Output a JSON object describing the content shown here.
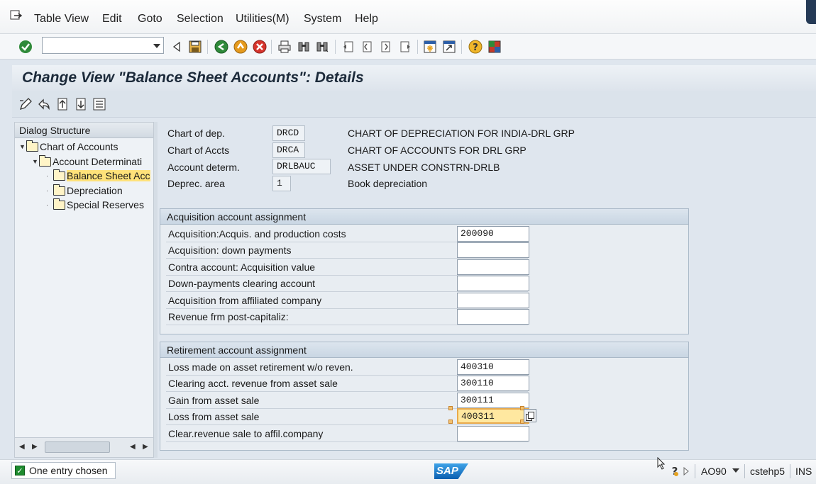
{
  "menubar": {
    "items": [
      "Table View",
      "Edit",
      "Goto",
      "Selection",
      "Utilities(M)",
      "System",
      "Help"
    ]
  },
  "toolbar": {
    "command_field": {
      "value": "",
      "placeholder": ""
    },
    "icons": [
      "enter-check-icon",
      "back-triangle-icon",
      "save-icon",
      "back-icon",
      "exit-icon",
      "cancel-icon",
      "print-icon",
      "find-icon",
      "find-next-icon",
      "first-page-icon",
      "prev-page-icon",
      "next-page-icon",
      "last-page-icon",
      "create-session-icon",
      "shortcut-icon",
      "help-icon",
      "customize-layout-icon"
    ]
  },
  "page": {
    "title": "Change View \"Balance Sheet Accounts\": Details"
  },
  "app_toolbar": {
    "icons": [
      "edit-icon",
      "undo-icon",
      "previous-entry-icon",
      "next-entry-icon",
      "variable-list-icon"
    ]
  },
  "tree": {
    "heading": "Dialog Structure",
    "items": [
      {
        "label": "Chart of Accounts",
        "level": 0,
        "expanded": true,
        "selected": false
      },
      {
        "label": "Account Determinati",
        "level": 1,
        "expanded": true,
        "selected": false
      },
      {
        "label": "Balance Sheet Acc",
        "level": 2,
        "expanded": false,
        "selected": true
      },
      {
        "label": "Depreciation",
        "level": 2,
        "expanded": false,
        "selected": false
      },
      {
        "label": "Special Reserves",
        "level": 2,
        "expanded": false,
        "selected": false
      }
    ]
  },
  "header_fields": [
    {
      "label": "Chart of dep.",
      "value": "DRCD",
      "description": "CHART OF DEPRECIATION FOR INDIA-DRL GRP"
    },
    {
      "label": "Chart of Accts",
      "value": "DRCA",
      "description": "CHART OF ACCOUNTS FOR DRL GRP"
    },
    {
      "label": "Account determ.",
      "value": "DRLBAUC",
      "description": "ASSET UNDER CONSTRN-DRLB"
    },
    {
      "label": "Deprec. area",
      "value": "1",
      "description": "Book depreciation"
    }
  ],
  "acquisition": {
    "title": "Acquisition account assignment",
    "rows": [
      {
        "label": "Acquisition:Acquis. and production costs",
        "value": "200090"
      },
      {
        "label": "Acquisition: down payments",
        "value": ""
      },
      {
        "label": "Contra account: Acquisition value",
        "value": ""
      },
      {
        "label": "Down-payments clearing account",
        "value": ""
      },
      {
        "label": "Acquisition from affiliated company",
        "value": ""
      },
      {
        "label": "Revenue frm post-capitaliz:",
        "value": ""
      }
    ]
  },
  "retirement": {
    "title": "Retirement account assignment",
    "rows": [
      {
        "label": "Loss made on asset retirement w/o reven.",
        "value": "400310"
      },
      {
        "label": "Clearing acct. revenue from asset sale",
        "value": "300110"
      },
      {
        "label": "Gain from asset sale",
        "value": "300111"
      },
      {
        "label": "Loss from asset sale",
        "value": "400311"
      },
      {
        "label": "Clear.revenue sale to affil.company",
        "value": ""
      }
    ]
  },
  "status": {
    "message": "One entry chosen",
    "logo": "SAP",
    "transaction": "AO90",
    "server": "cstehp5",
    "mode": "INS"
  },
  "colors": {
    "focus_field": "#ffe8a0",
    "selected_tree": "#ffe27a",
    "title_text": "#1c2a3a"
  }
}
